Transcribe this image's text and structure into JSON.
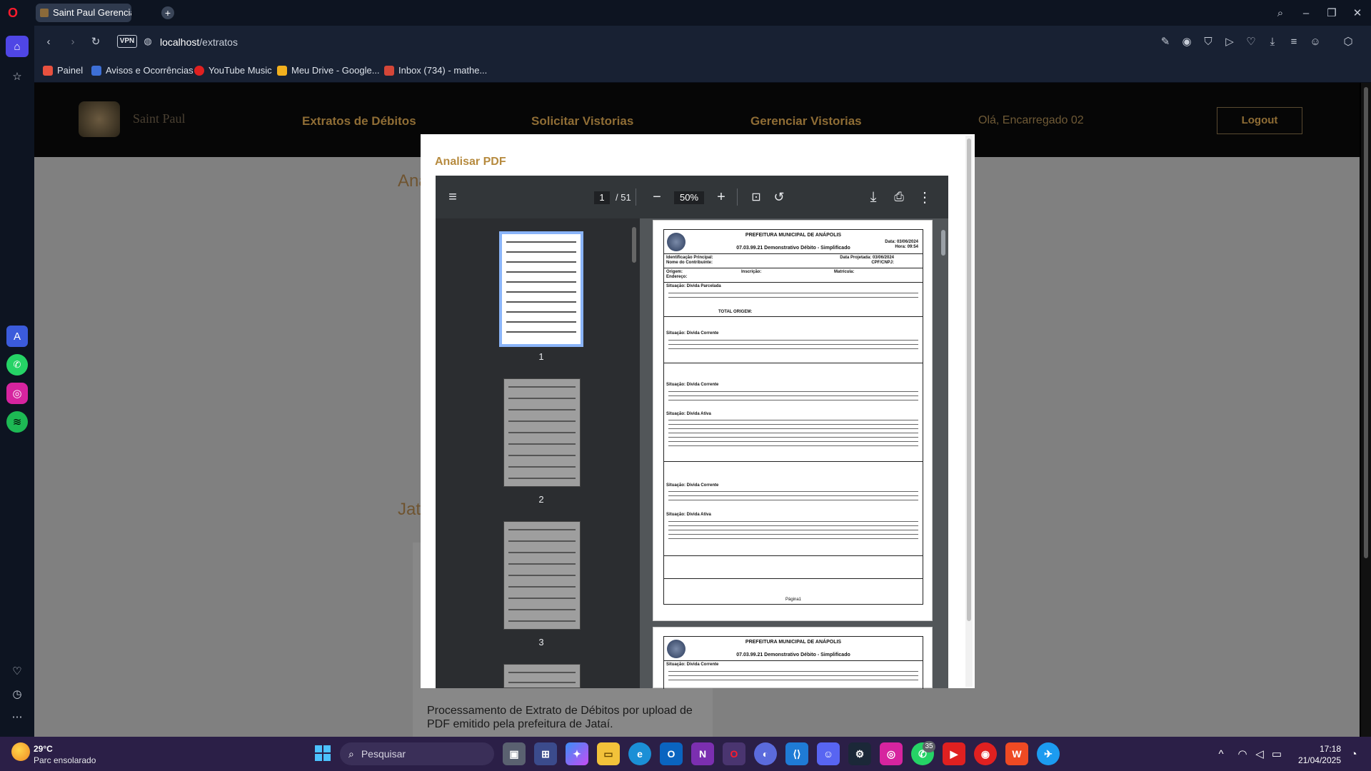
{
  "browser": {
    "tab_title": "Saint Paul Gerencia Imob",
    "new_tab": "+",
    "vpn": "VPN",
    "url_host": "localhost",
    "url_path": "/extratos",
    "bookmarks": [
      {
        "label": "Painel",
        "color": "#e8513f"
      },
      {
        "label": "Avisos e Ocorrências",
        "color": "#3d6fd6"
      },
      {
        "label": "YouTube Music",
        "color": "#e02020"
      },
      {
        "label": "Meu Drive - Google...",
        "color": "#f2b01e"
      },
      {
        "label": "Inbox (734) - mathe...",
        "color": "#d44638"
      }
    ]
  },
  "site": {
    "brand": "Saint Paul",
    "nav": [
      "Extratos de Débitos",
      "Solicitar Vistorias",
      "Gerenciar Vistorias"
    ],
    "greeting": "Olá, Encarregado 02",
    "logout": "Logout",
    "bg_heading_1": "Ana",
    "bg_heading_2": "Jat",
    "card_text": "Processamento de Extrato de Débitos por upload de PDF emitido pela prefeitura de Jataí."
  },
  "modal": {
    "title": "Analisar PDF",
    "pdf": {
      "current_page": "1",
      "total_pages": "/ 51",
      "zoom": "50%",
      "thumb_labels": [
        "1",
        "2",
        "3"
      ]
    },
    "doc": {
      "header": "PREFEITURA MUNICIPAL DE ANÁPOLIS",
      "subtitle": "07.03.99.21 Demonstrativo Débito - Simplificado",
      "date": "Data: 03/06/2024",
      "hour": "Hora: 09:54",
      "ident": "Identificação Principal:",
      "proj": "Data Projetada: 03/06/2024",
      "contrib": "Nome do Contribuinte:",
      "cpf": "CPF/CNPJ:",
      "origem": "Origem:",
      "inscricao": "Inscrição:",
      "matricula": "Matrícula:",
      "endereco": "Endereço:",
      "sit1": "Situação: Divida Parcelada",
      "sit2": "Situação: Divida Corrente",
      "sit3": "Situação: Divida Corrente",
      "sit4": "Situação: Divida Ativa",
      "sit5": "Situação: Divida Corrente",
      "sit6": "Situação: Divida Ativa",
      "total_origem": "TOTAL ORIGEM:",
      "footer": "Página1"
    }
  },
  "taskbar": {
    "weather_temp": "29°C",
    "weather_desc": "Parc ensolarado",
    "search": "Pesquisar",
    "time": "17:18",
    "date": "21/04/2025",
    "badge_whatsapp": "35"
  }
}
